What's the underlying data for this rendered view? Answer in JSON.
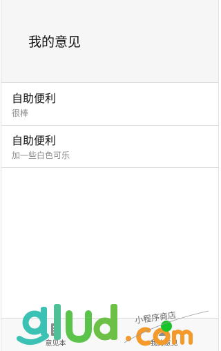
{
  "header": {
    "title": "我的意见"
  },
  "feedback_list": [
    {
      "name": "自助便利",
      "comment": "很棒"
    },
    {
      "name": "自助便利",
      "comment": "加一些白色可乐"
    }
  ],
  "tabbar": {
    "tabs": [
      {
        "label": "意见本",
        "icon": "notebook-icon"
      },
      {
        "label": "我的意见",
        "icon": "user-icon"
      }
    ]
  },
  "watermark": {
    "logo_text": "glud.com",
    "tagline": "小程序商店"
  },
  "colors": {
    "header_bg": "#f6f6f6",
    "divider": "#dcdcdc",
    "watermark_teal": "#3cc2b4",
    "watermark_green": "#5cc34a",
    "watermark_orange": "#f39a2b"
  }
}
